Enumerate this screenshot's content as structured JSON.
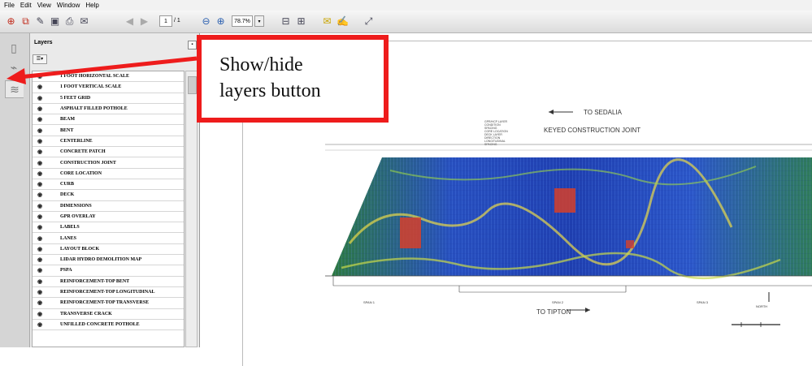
{
  "menu": [
    "File",
    "Edit",
    "View",
    "Window",
    "Help"
  ],
  "toolbar": {
    "page_current": "1",
    "page_total": "/ 1",
    "zoom": "78.7%"
  },
  "panel": {
    "title": "Layers",
    "layers": [
      "1 FOOT HORIZONTAL SCALE",
      "1 FOOT VERTICAL SCALE",
      "5 FEET GRID",
      "ASPHALT FILLED POTHOLE",
      "BEAM",
      "BENT",
      "CENTERLINE",
      "CONCRETE PATCH",
      "CONSTRUCTION JOINT",
      "CORE LOCATION",
      "CURB",
      "DECK",
      "DIMENSIONS",
      "GPR OVERLAY",
      "LABELS",
      "LANES",
      "LAYOUT BLOCK",
      "LIDAR HYDRO DEMOLITION MAP",
      "PSPA",
      "REINFORCEMENT-TOP BENT",
      "REINFORCEMENT-TOP LONGITUDINAL",
      "REINFORCEMENT-TOP TRANSVERSE",
      "TRANSVERSE CRACK",
      "UNFILLED CONCRETE POTHOLE"
    ]
  },
  "drawing": {
    "to_sedalia": "TO SEDALIA",
    "joint_label": "KEYED CONSTRUCTION JOINT",
    "to_tipton": "TO TIPTON",
    "span1": "SPAN 1",
    "span2": "SPAN 2",
    "span3": "SPAN 3",
    "north": "NORTH"
  },
  "callout": {
    "text": "Show/hide\nlayers button",
    "color": "#ee1c1c"
  }
}
